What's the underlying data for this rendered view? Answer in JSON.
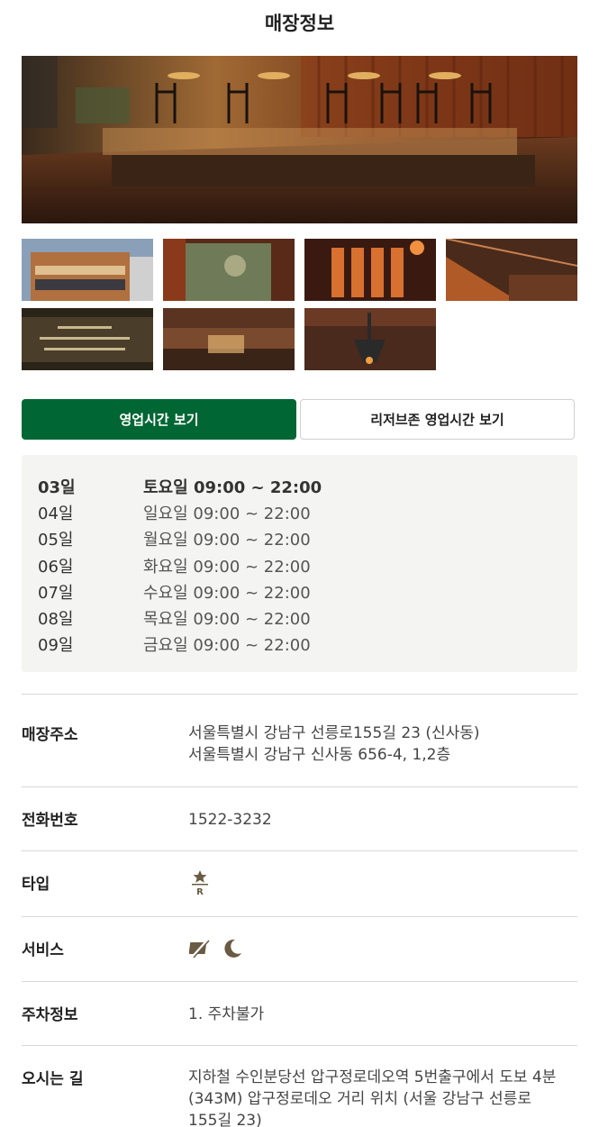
{
  "header": {
    "title": "매장정보"
  },
  "gallery": {
    "hero_alt": "store-interior-photo",
    "thumbnails": [
      "thumb-1",
      "thumb-2",
      "thumb-3",
      "thumb-4",
      "thumb-5",
      "thumb-6",
      "thumb-7"
    ]
  },
  "tabs": {
    "hours_label": "영업시간 보기",
    "reserve_hours_label": "리저브존 영업시간 보기"
  },
  "hours": [
    {
      "day": "03일",
      "time": "토요일 09:00 ~ 22:00",
      "today": true
    },
    {
      "day": "04일",
      "time": "일요일 09:00 ~ 22:00"
    },
    {
      "day": "05일",
      "time": "월요일 09:00 ~ 22:00"
    },
    {
      "day": "06일",
      "time": "화요일 09:00 ~ 22:00"
    },
    {
      "day": "07일",
      "time": "수요일 09:00 ~ 22:00"
    },
    {
      "day": "08일",
      "time": "목요일 09:00 ~ 22:00"
    },
    {
      "day": "09일",
      "time": "금요일 09:00 ~ 22:00"
    }
  ],
  "info": {
    "address": {
      "label": "매장주소",
      "line1": "서울특별시 강남구 선릉로155길 23 (신사동)",
      "line2": "서울특별시 강남구 신사동 656-4, 1,2층"
    },
    "phone": {
      "label": "전화번호",
      "value": "1522-3232"
    },
    "type": {
      "label": "타입",
      "icon": "reserve-star-icon",
      "icon_text": "R"
    },
    "service": {
      "label": "서비스",
      "icons": [
        "no-parking-flag-icon",
        "night-moon-icon"
      ]
    },
    "parking": {
      "label": "주차정보",
      "value": "1. 주차불가"
    },
    "directions": {
      "label": "오시는 길",
      "line1": "지하철 수인분당선 압구정로데오역 5번출구에서 도보 4분",
      "line2": "(343M) 압구정로데오 거리 위치 (서울 강남구 선릉로",
      "line3": "155길 23)"
    }
  },
  "colors": {
    "primary": "#006633",
    "hours_bg": "#f4f4f2",
    "icon": "#6b5a44"
  }
}
